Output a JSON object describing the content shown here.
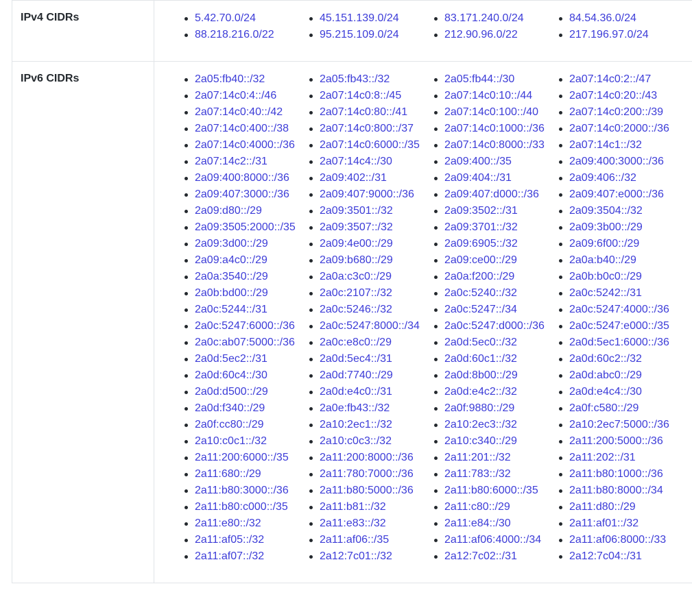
{
  "ipv4": {
    "label": "IPv4 CIDRs",
    "items": [
      "5.42.70.0/24",
      "45.151.139.0/24",
      "83.171.240.0/24",
      "84.54.36.0/24",
      "88.218.216.0/22",
      "95.215.109.0/24",
      "212.90.96.0/22",
      "217.196.97.0/24"
    ]
  },
  "ipv6": {
    "label": "IPv6 CIDRs",
    "items": [
      "2a05:fb40::/32",
      "2a05:fb43::/32",
      "2a05:fb44::/30",
      "2a07:14c0:2::/47",
      "2a07:14c0:4::/46",
      "2a07:14c0:8::/45",
      "2a07:14c0:10::/44",
      "2a07:14c0:20::/43",
      "2a07:14c0:40::/42",
      "2a07:14c0:80::/41",
      "2a07:14c0:100::/40",
      "2a07:14c0:200::/39",
      "2a07:14c0:400::/38",
      "2a07:14c0:800::/37",
      "2a07:14c0:1000::/36",
      "2a07:14c0:2000::/36",
      "2a07:14c0:4000::/36",
      "2a07:14c0:6000::/35",
      "2a07:14c0:8000::/33",
      "2a07:14c1::/32",
      "2a07:14c2::/31",
      "2a07:14c4::/30",
      "2a09:400::/35",
      "2a09:400:3000::/36",
      "2a09:400:8000::/36",
      "2a09:402::/31",
      "2a09:404::/31",
      "2a09:406::/32",
      "2a09:407:3000::/36",
      "2a09:407:9000::/36",
      "2a09:407:d000::/36",
      "2a09:407:e000::/36",
      "2a09:d80::/29",
      "2a09:3501::/32",
      "2a09:3502::/31",
      "2a09:3504::/32",
      "2a09:3505:2000::/35",
      "2a09:3507::/32",
      "2a09:3701::/32",
      "2a09:3b00::/29",
      "2a09:3d00::/29",
      "2a09:4e00::/29",
      "2a09:6905::/32",
      "2a09:6f00::/29",
      "2a09:a4c0::/29",
      "2a09:b680::/29",
      "2a09:ce00::/29",
      "2a0a:b40::/29",
      "2a0a:3540::/29",
      "2a0a:c3c0::/29",
      "2a0a:f200::/29",
      "2a0b:b0c0::/29",
      "2a0b:bd00::/29",
      "2a0c:2107::/32",
      "2a0c:5240::/32",
      "2a0c:5242::/31",
      "2a0c:5244::/31",
      "2a0c:5246::/32",
      "2a0c:5247::/34",
      "2a0c:5247:4000::/36",
      "2a0c:5247:6000::/36",
      "2a0c:5247:8000::/34",
      "2a0c:5247:d000::/36",
      "2a0c:5247:e000::/35",
      "2a0c:ab07:5000::/36",
      "2a0c:e8c0::/29",
      "2a0d:5ec0::/32",
      "2a0d:5ec1:6000::/36",
      "2a0d:5ec2::/31",
      "2a0d:5ec4::/31",
      "2a0d:60c1::/32",
      "2a0d:60c2::/32",
      "2a0d:60c4::/30",
      "2a0d:7740::/29",
      "2a0d:8b00::/29",
      "2a0d:abc0::/29",
      "2a0d:d500::/29",
      "2a0d:e4c0::/31",
      "2a0d:e4c2::/32",
      "2a0d:e4c4::/30",
      "2a0d:f340::/29",
      "2a0e:fb43::/32",
      "2a0f:9880::/29",
      "2a0f:c580::/29",
      "2a0f:cc80::/29",
      "2a10:2ec1::/32",
      "2a10:2ec3::/32",
      "2a10:2ec7:5000::/36",
      "2a10:c0c1::/32",
      "2a10:c0c3::/32",
      "2a10:c340::/29",
      "2a11:200:5000::/36",
      "2a11:200:6000::/35",
      "2a11:200:8000::/36",
      "2a11:201::/32",
      "2a11:202::/31",
      "2a11:680::/29",
      "2a11:780:7000::/36",
      "2a11:783::/32",
      "2a11:b80:1000::/36",
      "2a11:b80:3000::/36",
      "2a11:b80:5000::/36",
      "2a11:b80:6000::/35",
      "2a11:b80:8000::/34",
      "2a11:b80:c000::/35",
      "2a11:b81::/32",
      "2a11:c80::/29",
      "2a11:d80::/29",
      "2a11:e80::/32",
      "2a11:e83::/32",
      "2a11:e84::/30",
      "2a11:af01::/32",
      "2a11:af05::/32",
      "2a11:af06::/35",
      "2a11:af06:4000::/34",
      "2a11:af06:8000::/33",
      "2a11:af07::/32",
      "2a12:7c01::/32",
      "2a12:7c02::/31",
      "2a12:7c04::/31"
    ]
  }
}
